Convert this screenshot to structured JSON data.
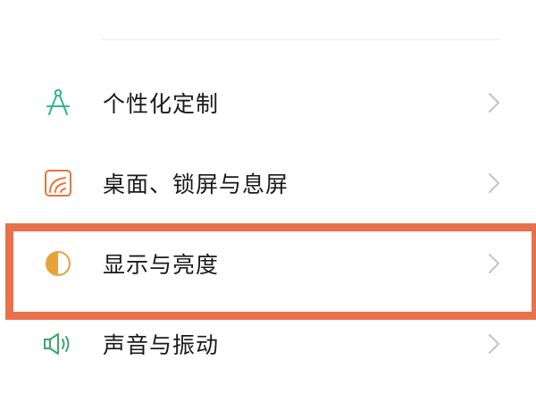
{
  "settings": {
    "items": [
      {
        "label": "个性化定制",
        "icon": "compass-drafting-icon",
        "icon_color": "#2fb78a"
      },
      {
        "label": "桌面、锁屏与息屏",
        "icon": "wallpaper-icon",
        "icon_color": "#e8743a"
      },
      {
        "label": "显示与亮度",
        "icon": "brightness-icon",
        "icon_color": "#e8a23a"
      },
      {
        "label": "声音与振动",
        "icon": "speaker-icon",
        "icon_color": "#3aa86b"
      }
    ]
  },
  "highlight": {
    "target": "显示与亮度",
    "color": "#e8704a"
  },
  "colors": {
    "chevron": "#c4c4c4",
    "text": "#1a1a1a",
    "divider": "#ececec"
  }
}
